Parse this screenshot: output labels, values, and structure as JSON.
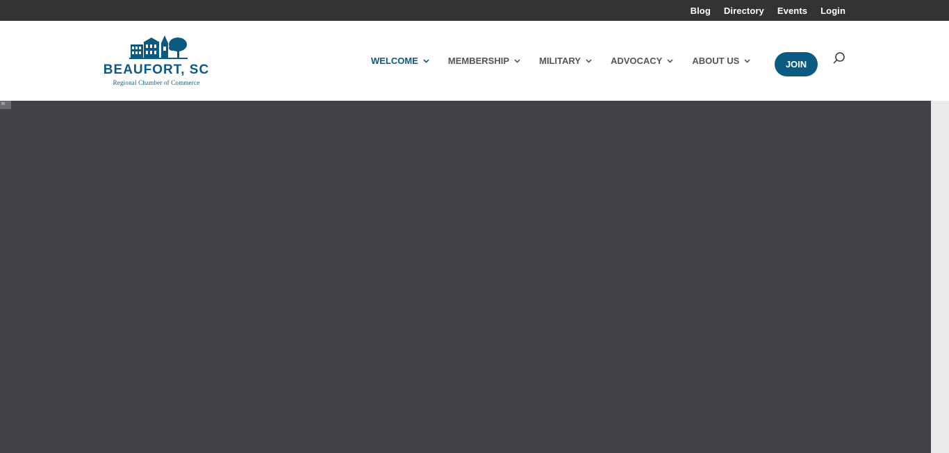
{
  "top_bar": {
    "links": [
      {
        "label": "Blog"
      },
      {
        "label": "Directory"
      },
      {
        "label": "Events"
      },
      {
        "label": "Login"
      }
    ]
  },
  "logo": {
    "title": "BEAUFORT, SC",
    "subtitle": "Regional Chamber of Commerce"
  },
  "nav": {
    "items": [
      {
        "label": "WELCOME",
        "active": true
      },
      {
        "label": "MEMBERSHIP"
      },
      {
        "label": "MILITARY"
      },
      {
        "label": "ADVOCACY"
      },
      {
        "label": "ABOUT US"
      }
    ],
    "join_label": "JOIN"
  },
  "colors": {
    "brand": "#0a5a82",
    "top_bar": "#333333",
    "hero": "#414246",
    "nav_text": "#555555"
  },
  "icons": {
    "search": "search-icon",
    "dropdown": "chevron-down-icon"
  }
}
